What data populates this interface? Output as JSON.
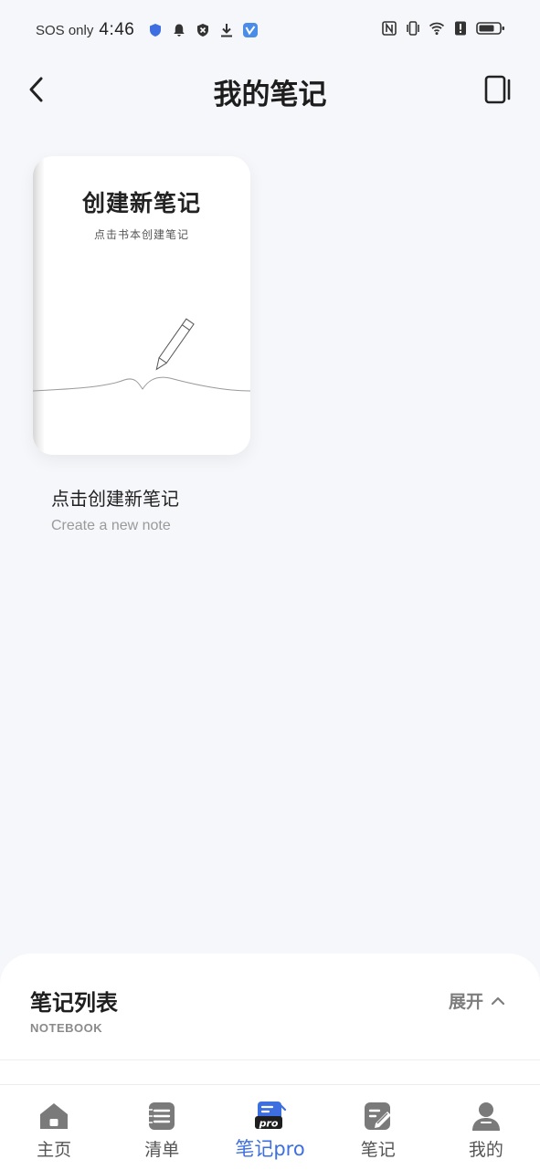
{
  "status_bar": {
    "carrier": "SOS only",
    "time": "4:46",
    "icons_left": [
      "shield-icon",
      "bell-icon",
      "blocked-icon",
      "download-icon",
      "app-badge-icon"
    ],
    "icons_right": [
      "nfc-icon",
      "vibrate-icon",
      "wifi-icon",
      "alert-icon",
      "battery-icon"
    ]
  },
  "header": {
    "title": "我的笔记",
    "back_icon": "chevron-left-icon",
    "layout_icon": "layout-toggle-icon"
  },
  "note_card": {
    "cover_title": "创建新笔记",
    "cover_subtitle": "点击书本创建笔记",
    "caption": "点击创建新笔记",
    "caption_en": "Create a new note"
  },
  "notebook_panel": {
    "title": "笔记列表",
    "subtitle": "NOTEBOOK",
    "expand_label": "展开"
  },
  "tabs": [
    {
      "label": "主页",
      "icon": "home-icon",
      "active": false
    },
    {
      "label": "清单",
      "icon": "checklist-icon",
      "active": false
    },
    {
      "label": "笔记pro",
      "icon": "notes-pro-icon",
      "active": true
    },
    {
      "label": "笔记",
      "icon": "edit-note-icon",
      "active": false
    },
    {
      "label": "我的",
      "icon": "profile-icon",
      "active": false
    }
  ],
  "colors": {
    "background": "#f6f7fa",
    "accent": "#3d6fe0",
    "text_primary": "#1d1d1d",
    "text_secondary": "#9a9a9a"
  }
}
